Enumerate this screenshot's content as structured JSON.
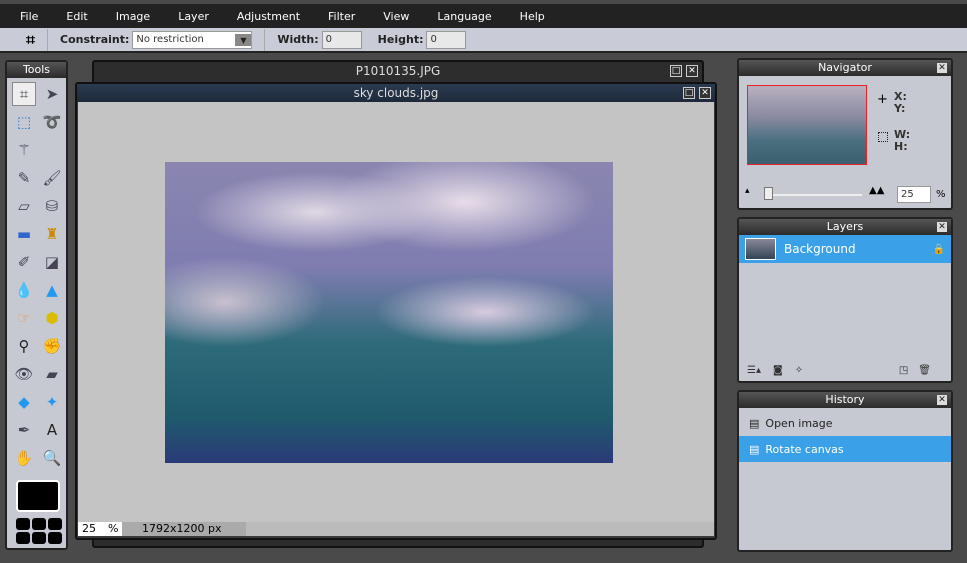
{
  "menu": [
    "File",
    "Edit",
    "Image",
    "Layer",
    "Adjustment",
    "Filter",
    "View",
    "Language",
    "Help"
  ],
  "toolbar": {
    "constraint_label": "Constraint:",
    "constraint_value": "No restriction",
    "width_label": "Width:",
    "width_value": "0",
    "height_label": "Height:",
    "height_value": "0"
  },
  "tools_panel": {
    "title": "Tools",
    "tools": [
      "crop",
      "move",
      "marquee",
      "lasso",
      "magic-wand",
      "pencil",
      "brush",
      "eraser",
      "paint-bucket",
      "gradient",
      "clone-stamp",
      "color-replace",
      "draw-shape",
      "blur",
      "sharpen",
      "smudge",
      "sponge",
      "dodge",
      "burn",
      "red-eye",
      "spot-heal",
      "bloat",
      "pinch",
      "color-picker",
      "type",
      "hand",
      "zoom"
    ],
    "primary_color": "#000000"
  },
  "windows": {
    "back": {
      "title": "P1010135.JPG"
    },
    "front": {
      "title": "sky clouds.jpg",
      "zoom": "25",
      "zoom_unit": "%",
      "dimensions": "1792x1200 px"
    }
  },
  "navigator": {
    "title": "Navigator",
    "x_label": "X:",
    "y_label": "Y:",
    "w_label": "W:",
    "h_label": "H:",
    "zoom": "25",
    "zoom_unit": "%",
    "zoom_level_percent": 25
  },
  "layers": {
    "title": "Layers",
    "items": [
      {
        "name": "Background",
        "locked": true
      }
    ]
  },
  "history": {
    "title": "History",
    "items": [
      {
        "label": "Open image",
        "selected": false
      },
      {
        "label": "Rotate canvas",
        "selected": true
      }
    ]
  },
  "colors": {
    "selection": "#3aa0e8",
    "menubar": "#222222"
  }
}
